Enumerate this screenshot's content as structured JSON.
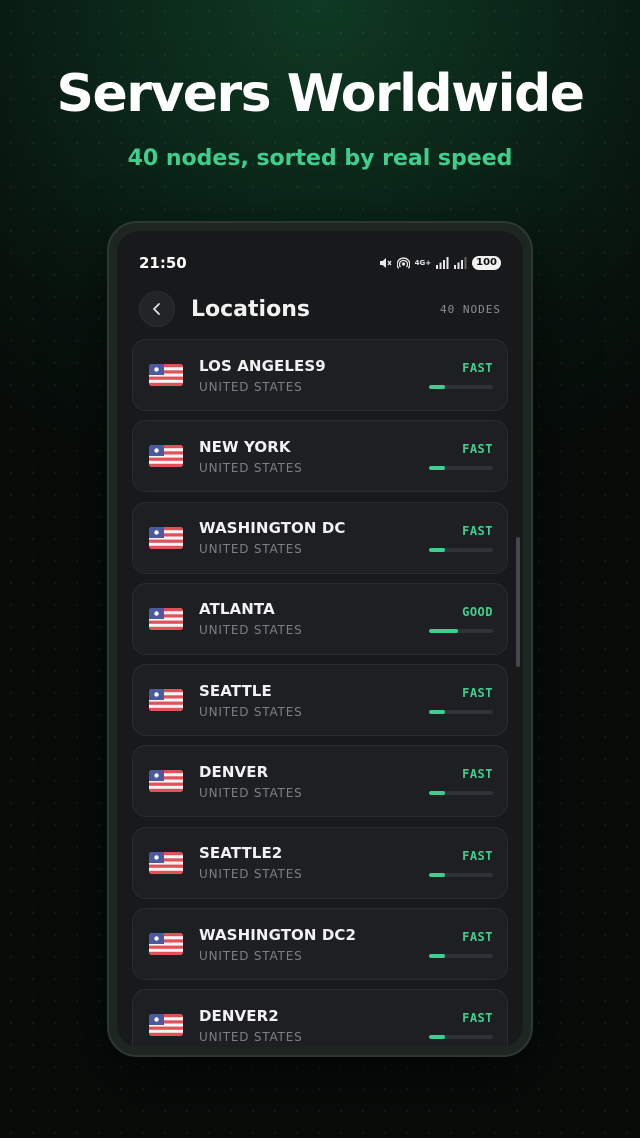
{
  "headline": "Servers Worldwide",
  "subheadline": "40 nodes, sorted by real speed",
  "status_bar": {
    "time": "21:50",
    "network": "4G+",
    "battery": "100",
    "icons": [
      "mute-icon",
      "hotspot-icon",
      "signal-icon",
      "signal-icon",
      "battery-icon"
    ]
  },
  "header": {
    "title": "Locations",
    "node_count": "40 NODES"
  },
  "colors": {
    "accent": "#3ecf8e",
    "card_bg": "#1d1f22",
    "screen_bg": "#18191b"
  },
  "servers": [
    {
      "city": "LOS ANGELES9",
      "country": "UNITED STATES",
      "speed_label": "FAST",
      "speed_level": 0.25
    },
    {
      "city": "NEW YORK",
      "country": "UNITED STATES",
      "speed_label": "FAST",
      "speed_level": 0.25
    },
    {
      "city": "WASHINGTON DC",
      "country": "UNITED STATES",
      "speed_label": "FAST",
      "speed_level": 0.25
    },
    {
      "city": "ATLANTA",
      "country": "UNITED STATES",
      "speed_label": "GOOD",
      "speed_level": 0.45
    },
    {
      "city": "SEATTLE",
      "country": "UNITED STATES",
      "speed_label": "FAST",
      "speed_level": 0.25
    },
    {
      "city": "DENVER",
      "country": "UNITED STATES",
      "speed_label": "FAST",
      "speed_level": 0.25
    },
    {
      "city": "SEATTLE2",
      "country": "UNITED STATES",
      "speed_label": "FAST",
      "speed_level": 0.25
    },
    {
      "city": "WASHINGTON DC2",
      "country": "UNITED STATES",
      "speed_label": "FAST",
      "speed_level": 0.25
    },
    {
      "city": "DENVER2",
      "country": "UNITED STATES",
      "speed_label": "FAST",
      "speed_level": 0.25
    }
  ]
}
